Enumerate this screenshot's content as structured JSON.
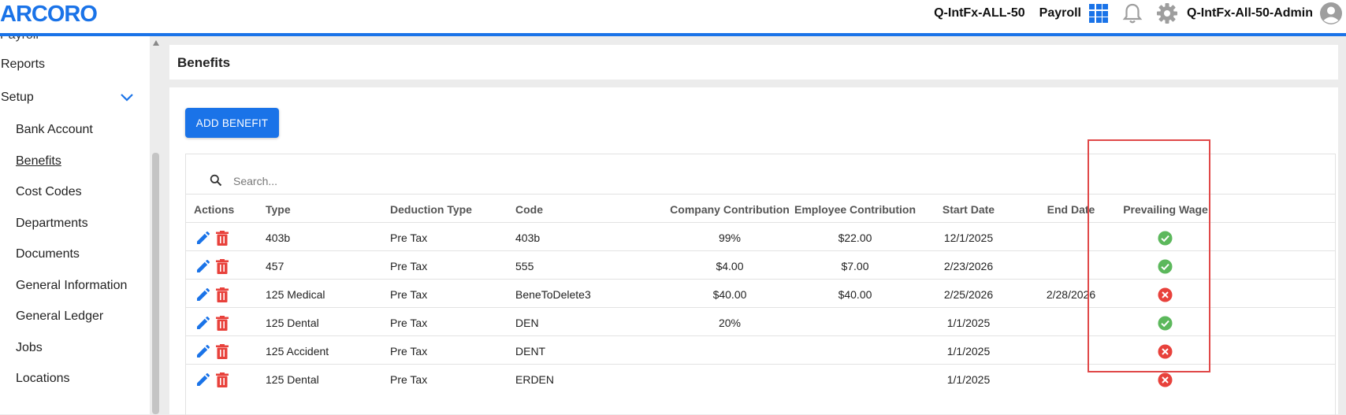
{
  "header": {
    "logo_text": "ARCORO",
    "tenant": "Q-IntFx-ALL-50",
    "module": "Payroll",
    "user": "Q-IntFx-All-50-Admin",
    "icons": [
      "apps-grid-icon",
      "bell-icon",
      "gear-icon",
      "avatar-icon"
    ],
    "accent_color": "#1a73e8"
  },
  "sidebar": {
    "partial_item": "Payroll",
    "items": [
      {
        "label": "Reports"
      },
      {
        "label": "Setup"
      }
    ],
    "sub_items": [
      {
        "label": "Bank Account"
      },
      {
        "label": "Benefits",
        "active": true
      },
      {
        "label": "Cost Codes"
      },
      {
        "label": "Departments"
      },
      {
        "label": "Documents"
      },
      {
        "label": "General Information"
      },
      {
        "label": "General Ledger"
      },
      {
        "label": "Jobs"
      },
      {
        "label": "Locations"
      }
    ]
  },
  "page": {
    "title": "Benefits",
    "add_button": "ADD BENEFIT",
    "search_placeholder": "Search..."
  },
  "table": {
    "columns": [
      "Actions",
      "Type",
      "Deduction Type",
      "Code",
      "Company Contribution",
      "Employee Contribution",
      "Start Date",
      "End Date",
      "Prevailing Wage"
    ],
    "rows": [
      {
        "type": "403b",
        "deduction_type": "Pre Tax",
        "code": "403b",
        "company": "99%",
        "employee": "$22.00",
        "start": "12/1/2025",
        "end": "",
        "prevailing": true
      },
      {
        "type": "457",
        "deduction_type": "Pre Tax",
        "code": "555",
        "company": "$4.00",
        "employee": "$7.00",
        "start": "2/23/2026",
        "end": "",
        "prevailing": true
      },
      {
        "type": "125 Medical",
        "deduction_type": "Pre Tax",
        "code": "BeneToDelete3",
        "company": "$40.00",
        "employee": "$40.00",
        "start": "2/25/2026",
        "end": "2/28/2026",
        "prevailing": false
      },
      {
        "type": "125 Dental",
        "deduction_type": "Pre Tax",
        "code": "DEN",
        "company": "20%",
        "employee": "",
        "start": "1/1/2025",
        "end": "",
        "prevailing": true
      },
      {
        "type": "125 Accident",
        "deduction_type": "Pre Tax",
        "code": "DENT",
        "company": "",
        "employee": "",
        "start": "1/1/2025",
        "end": "",
        "prevailing": false
      },
      {
        "type": "125 Dental",
        "deduction_type": "Pre Tax",
        "code": "ERDEN",
        "company": "",
        "employee": "",
        "start": "1/1/2025",
        "end": "",
        "prevailing": false
      }
    ],
    "status_colors": {
      "yes": "#5cb85c",
      "no": "#e8413b"
    },
    "action_colors": {
      "edit": "#1a73e8",
      "delete": "#e8413b"
    }
  }
}
